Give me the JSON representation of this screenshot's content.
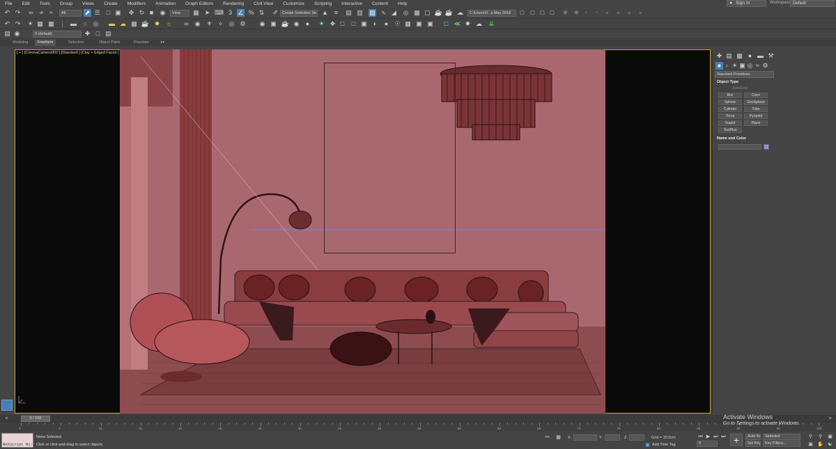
{
  "menu": {
    "items": [
      "File",
      "Edit",
      "Tools",
      "Group",
      "Views",
      "Create",
      "Modifiers",
      "Animation",
      "Graph Editors",
      "Rendering",
      "Civil View",
      "Customize",
      "Scripting",
      "Interactive",
      "Content",
      "Help"
    ],
    "sign_in": "Sign In",
    "workspaces_label": "Workspaces:",
    "workspace_value": "Default"
  },
  "toolbar": {
    "selection_filter": "All",
    "ref_coord": "View",
    "named_selection": "Create Selection Se",
    "project_path": "C:\\Users\\V...s Max 2018"
  },
  "layers": {
    "layer_name": "0 (default)"
  },
  "ribbon": {
    "tabs": [
      "Modeling",
      "Freeform",
      "Selection",
      "Object Paint",
      "Populate"
    ],
    "active_tab": "Freeform"
  },
  "viewport": {
    "label": "[ + ] [CoronaCamera002 ] [Standard ] [Clay + Edged Faces ]",
    "scene_background": "#a96870",
    "frame_border_color": "#c8a03a"
  },
  "command_panel": {
    "category": "Standard Primitives",
    "object_type_header": "Object Type",
    "autogrid": "AutoGrid",
    "buttons": [
      "Box",
      "Cone",
      "Sphere",
      "GeoSphere",
      "Cylinder",
      "Tube",
      "Torus",
      "Pyramid",
      "Teapot",
      "Plane",
      "TextPlus"
    ],
    "name_color_header": "Name and Color",
    "swatch_color": "#a08cd8"
  },
  "timeline": {
    "frame_display": "0 / 100",
    "ticks": [
      0,
      5,
      10,
      15,
      20,
      25,
      30,
      35,
      40,
      45,
      50,
      55,
      60,
      65,
      70,
      75,
      80,
      85,
      90,
      95,
      100
    ]
  },
  "status": {
    "maxscript_label": "MAXScript Mi:",
    "selection_status": "None Selected",
    "prompt": "Click or click-and-drag to select objects",
    "x_label": "X:",
    "y_label": "Y:",
    "z_label": "Z:",
    "grid": "Grid = 10.0cm",
    "add_time_tag": "Add Time Tag",
    "auto_key": "Auto Key",
    "set_key": "Set Key",
    "key_mode": "Selected",
    "key_filters": "Key Filters...",
    "current_frame": "0"
  },
  "windows_watermark": {
    "title": "Activate Windows",
    "subtitle": "Go to Settings to activate Windows."
  }
}
